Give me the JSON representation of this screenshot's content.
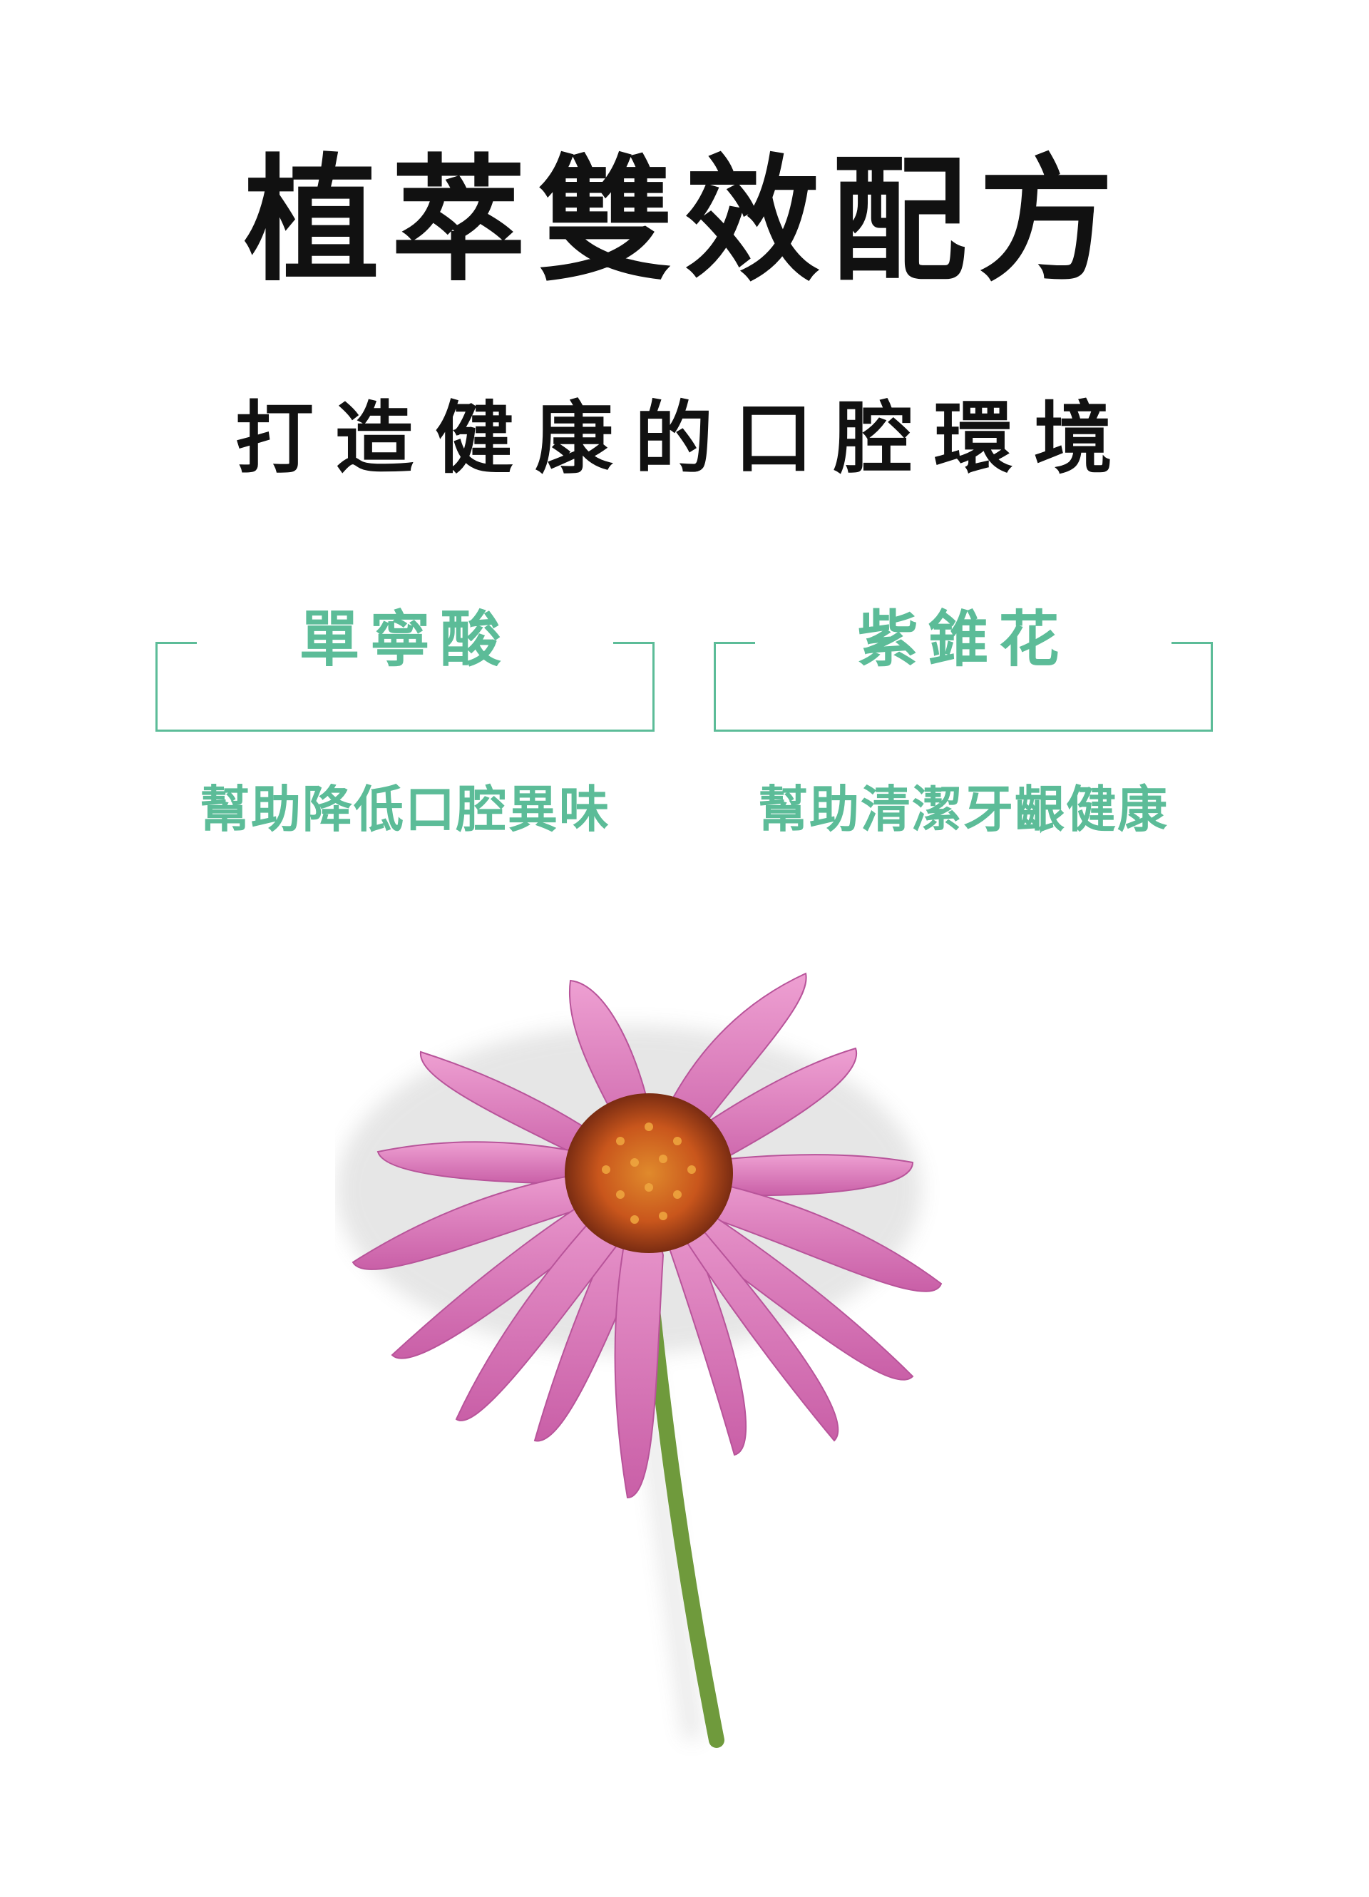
{
  "title": "植萃雙效配方",
  "subtitle": "打造健康的口腔環境",
  "ingredients": [
    {
      "name": "單寧酸",
      "benefit": "幫助降低口腔異味"
    },
    {
      "name": "紫錐花",
      "benefit": "幫助清潔牙齦健康"
    }
  ],
  "colors": {
    "accent": "#5cbc98",
    "text": "#111111",
    "petal": "#de7fbf",
    "petal_dark": "#b8549a",
    "cone": "#c9561c",
    "stem": "#6f9a3c"
  },
  "image": {
    "subject": "echinacea-flower"
  }
}
